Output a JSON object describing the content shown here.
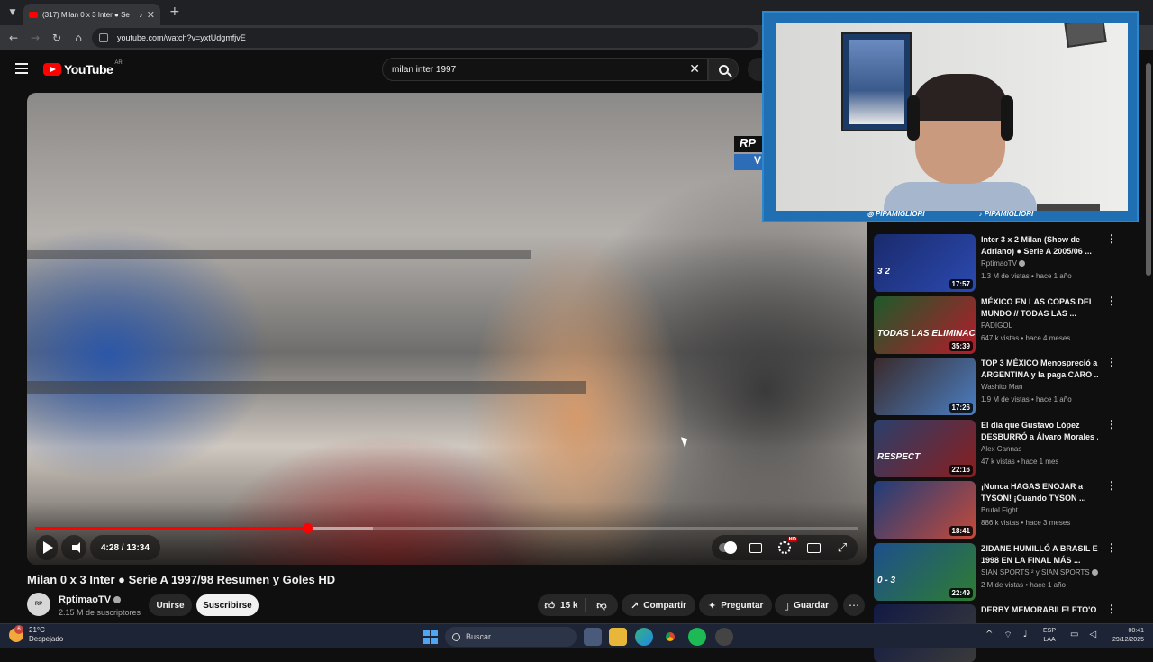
{
  "browser": {
    "tab_title": "(317) Milan 0 x 3 Inter ● Se",
    "url": "youtube.com/watch?v=yxtUdgmfjvE"
  },
  "youtube": {
    "logo_text": "YouTube",
    "country_code": "AR",
    "search_value": "milan inter  1997"
  },
  "video": {
    "overlay_text_1": "RP",
    "overlay_text_2": "V",
    "time_display": "4:28 / 13:34",
    "progress_played_fraction": 0.33,
    "progress_buffered_fraction": 0.41,
    "title": "Milan 0 x 3 Inter ● Serie A 1997/98 Resumen y Goles HD",
    "channel_name": "RptimaoTV",
    "channel_avatar_text": "RP",
    "subscribers": "2.15 M de suscriptores",
    "join_label": "Unirse",
    "subscribe_label": "Suscribirse",
    "likes": "15 k",
    "share_label": "Compartir",
    "ask_label": "Preguntar",
    "save_label": "Guardar"
  },
  "webcam": {
    "instagram_handle": "PIPAMIGLIORI",
    "tiktok_handle": "PIPAMIGLIORI"
  },
  "recommendations": [
    {
      "title_line1": "Inter 3 x 2 Milan (Show de",
      "title_line2": "Adriano) ● Serie A 2005/06 ...",
      "channel": "RptimaoTV",
      "verified": true,
      "meta": "1.3 M de vistas • hace 1 año",
      "duration": "17:57",
      "thumb_colors": [
        "#1a2a6c",
        "#2b4ab0"
      ],
      "thumb_text": "3  2"
    },
    {
      "title_line1": "MÉXICO EN LAS COPAS DEL",
      "title_line2": "MUNDO // TODAS LAS ...",
      "channel": "PADIGOL",
      "verified": false,
      "meta": "647 k vistas • hace 4 meses",
      "duration": "35:39",
      "thumb_colors": [
        "#1d5a2a",
        "#b51b2b"
      ],
      "thumb_text": "TODAS LAS ELIMINACIONES"
    },
    {
      "title_line1": "TOP 3 MÉXICO Menospreció a",
      "title_line2": "ARGENTINA y la paga CARO ...",
      "channel": "Washito Man",
      "verified": false,
      "meta": "1.9 M de vistas • hace 1 año",
      "duration": "17:26",
      "thumb_colors": [
        "#3a2a2a",
        "#4a7ec2"
      ],
      "thumb_text": ""
    },
    {
      "title_line1": "El día que Gustavo López",
      "title_line2": "DESBURRÓ a Álvaro Morales ...",
      "channel": "Alex Cannas",
      "verified": false,
      "meta": "47 k vistas • hace 1 mes",
      "duration": "22:16",
      "thumb_colors": [
        "#2a3f6b",
        "#8a1e1e"
      ],
      "thumb_text": "RESPECT"
    },
    {
      "title_line1": "¡Nunca HAGAS ENOJAR a",
      "title_line2": "TYSON! ¡Cuando TYSON ...",
      "channel": "Brutal Fight",
      "verified": false,
      "meta": "886 k vistas • hace 3 meses",
      "duration": "18:41",
      "thumb_colors": [
        "#1e3d7a",
        "#c44a3a"
      ],
      "thumb_text": ""
    },
    {
      "title_line1": "ZIDANE HUMILLÓ A BRASIL EN",
      "title_line2": "1998 EN LA FINAL MÁS ...",
      "channel": "SIAN SPORTS ² y SIAN SPORTS",
      "verified": true,
      "meta": "2 M de vistas • hace 1 año",
      "duration": "22:49",
      "thumb_colors": [
        "#1d4f8c",
        "#2e7d32"
      ],
      "thumb_text": "0 - 3"
    },
    {
      "title_line1": "DERBY MEMORABILE! ETO'O vs",
      "title_line2": "",
      "channel": "",
      "verified": false,
      "meta": "",
      "duration": "",
      "thumb_colors": [
        "#111a44",
        "#3a3a3a"
      ],
      "thumb_text": ""
    }
  ],
  "taskbar": {
    "temperature": "21°C",
    "weather": "Despejado",
    "weather_badge": "6",
    "search_label": "Buscar",
    "lang_line1": "ESP",
    "lang_line2": "LAA",
    "time": "00:41",
    "date": "29/12/2025"
  }
}
